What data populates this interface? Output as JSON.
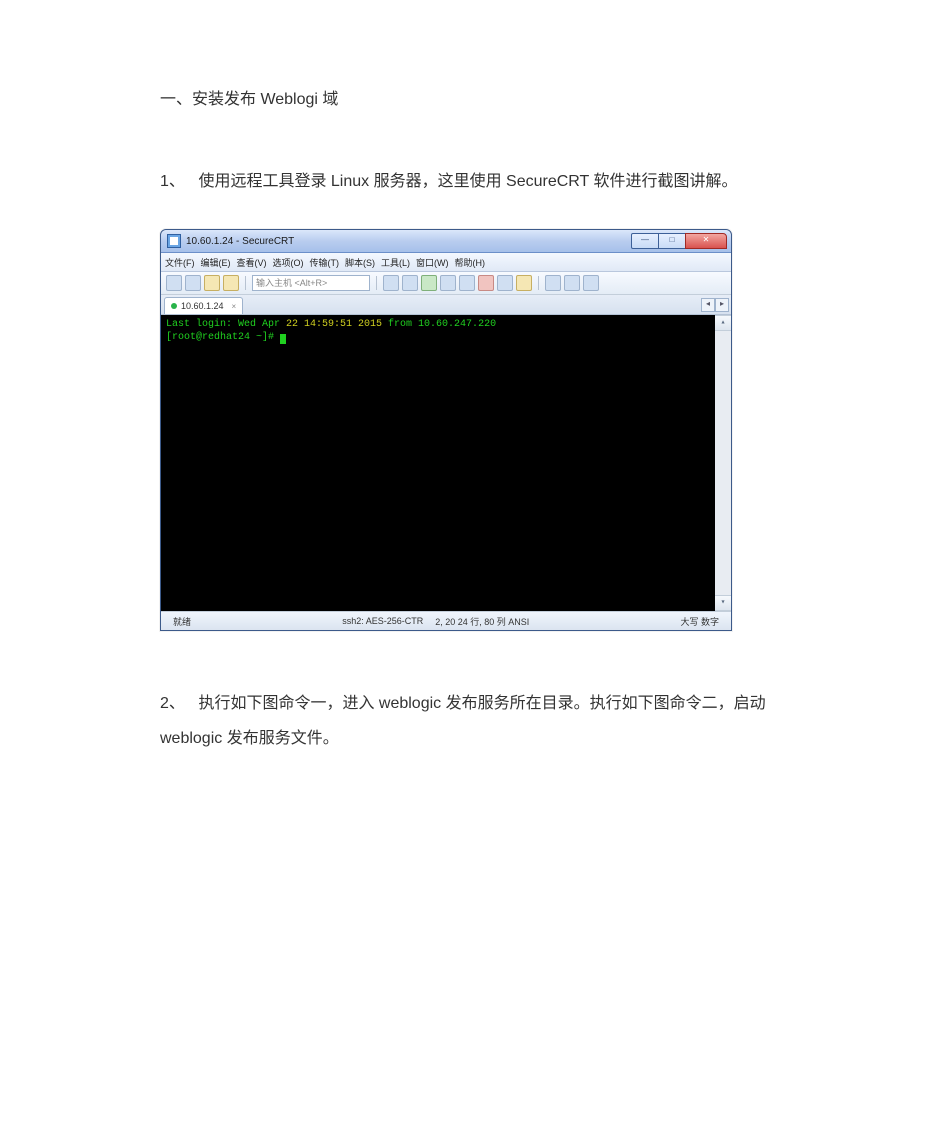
{
  "doc": {
    "heading": "一、安装发布 Weblogi 域",
    "step1_num": "1、",
    "step1_text": "使用远程工具登录 Linux 服务器，这里使用 SecureCRT 软件进行截图讲解。",
    "step2_num": "2、",
    "step2_text": "执行如下图命令一，进入 weblogic 发布服务所在目录。执行如下图命令二，启动 weblogic 发布服务文件。"
  },
  "crt": {
    "title": "10.60.1.24 - SecureCRT",
    "menus": [
      "文件(F)",
      "编辑(E)",
      "查看(V)",
      "选项(O)",
      "传输(T)",
      "脚本(S)",
      "工具(L)",
      "窗口(W)",
      "帮助(H)"
    ],
    "host_placeholder": "输入主机 <Alt+R>",
    "tab_label": "10.60.1.24",
    "tab_close": "×",
    "term_line1_a": "Last login: Wed Apr ",
    "term_line1_b": "22 14:59:51 2015",
    "term_line1_c": " from 10.60.247.220",
    "term_line2": "[root@redhat24 ~]# ",
    "status_ready": "就绪",
    "status_ssh": "ssh2: AES-256-CTR",
    "status_pos": "2, 20   24 行, 80 列   ANSI",
    "status_caps": "大写 数字",
    "scroll_left": "◂",
    "scroll_right": "▸",
    "scroll_up": "▴",
    "scroll_down": "▾",
    "min_glyph": "—",
    "max_glyph": "□",
    "close_glyph": "✕"
  }
}
